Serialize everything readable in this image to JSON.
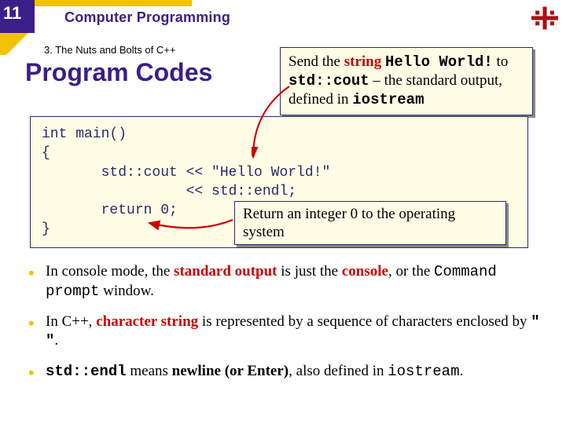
{
  "page_number": "11",
  "header": "Computer Programming",
  "section": "3. The Nuts and Bolts of C++",
  "title": "Program Codes",
  "code": {
    "l1": "int main()",
    "l2": "{",
    "l3": "       std::cout << \"Hello World!\"",
    "l4": "                 << std::endl;",
    "l5": "       return 0;",
    "l6": "}"
  },
  "callout1": {
    "t1": "Send the ",
    "t2": "string",
    "t3": " ",
    "t4": "Hello World!",
    "t5": " to ",
    "t6": "std::cout",
    "t7": " – the standard output, defined in ",
    "t8": "iostream"
  },
  "callout2": {
    "t1": "Return an integer 0 to the operating system"
  },
  "bullets": {
    "b1": {
      "t1": "In console mode, the ",
      "t2": "standard output",
      "t3": " is just the ",
      "t4": "console",
      "t5": ", or the ",
      "t6": "Command prompt",
      "t7": " window."
    },
    "b2": {
      "t1": "In C++, ",
      "t2": "character string",
      "t3": " is represented by a sequence of characters enclosed by ",
      "t4": "\" \"",
      "t5": "."
    },
    "b3": {
      "t1": "std::endl",
      "t2": " means ",
      "t3": "newline (or Enter)",
      "t4": ", also defined in ",
      "t5": "iostream",
      "t6": "."
    }
  }
}
